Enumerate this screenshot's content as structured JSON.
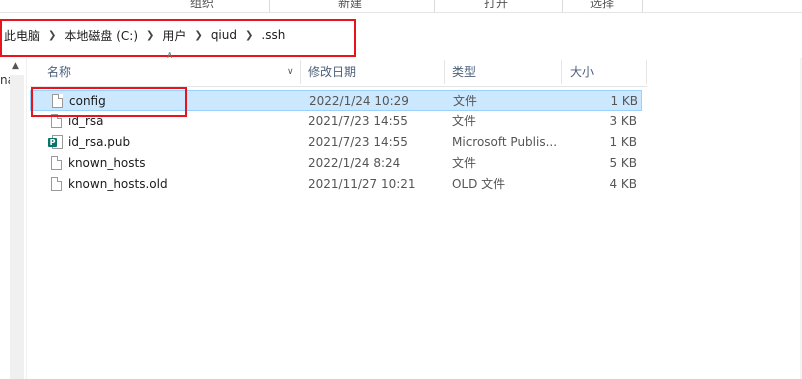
{
  "ribbon": {
    "groups": [
      "组织",
      "新建",
      "打开",
      "选择"
    ]
  },
  "address_bar": {
    "crumbs": [
      "此电脑",
      "本地磁盘 (C:)",
      "用户",
      "qiud",
      ".ssh"
    ]
  },
  "nav_pane": {
    "cut_text": "na"
  },
  "columns": {
    "name": "名称",
    "date": "修改日期",
    "type": "类型",
    "size": "大小"
  },
  "files": [
    {
      "name": "config",
      "date": "2022/1/24 10:29",
      "type": "文件",
      "size": "1 KB",
      "icon": "file-icon",
      "selected": true
    },
    {
      "name": "id_rsa",
      "date": "2021/7/23 14:55",
      "type": "文件",
      "size": "3 KB",
      "icon": "file-icon",
      "selected": false
    },
    {
      "name": "id_rsa.pub",
      "date": "2021/7/23 14:55",
      "type": "Microsoft Publis...",
      "size": "1 KB",
      "icon": "publisher-file-icon",
      "selected": false
    },
    {
      "name": "known_hosts",
      "date": "2022/1/24 8:24",
      "type": "文件",
      "size": "5 KB",
      "icon": "file-icon",
      "selected": false
    },
    {
      "name": "known_hosts.old",
      "date": "2021/11/27 10:21",
      "type": "OLD 文件",
      "size": "4 KB",
      "icon": "file-icon",
      "selected": false
    }
  ],
  "colors": {
    "selection": "#cce8ff",
    "highlight_box": "#e8141c",
    "header_text": "#4c607a"
  }
}
